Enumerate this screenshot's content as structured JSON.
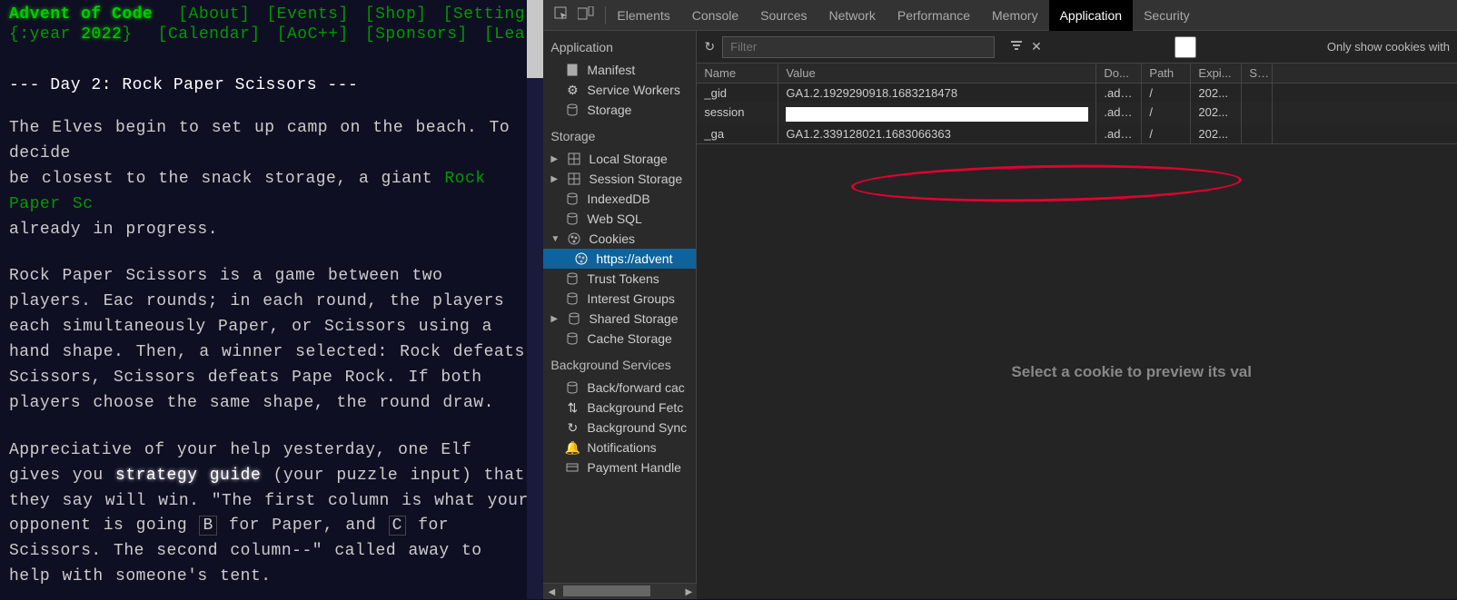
{
  "aoc": {
    "title": "Advent of Code",
    "nav": {
      "about": "[About]",
      "events": "[Events]",
      "shop": "[Shop]",
      "settings": "[Settings]"
    },
    "year_prefix": "{:year ",
    "year": "2022",
    "year_suffix": "}",
    "subnav": {
      "calendar": "[Calendar]",
      "aocpp": "[AoC++]",
      "sponsors": "[Sponsors]",
      "leaderboard": "[Lea"
    },
    "h2": "--- Day 2: Rock Paper Scissors ---",
    "p1a": "The Elves begin to set up camp on the beach. To decide",
    "p1b": "be closest to the snack storage, a giant ",
    "p1link": "Rock Paper Sc",
    "p1c": "already in progress.",
    "p2": "Rock Paper Scissors is a game between two players. Eac rounds; in each round, the players each simultaneously Paper, or Scissors using a hand shape. Then, a winner selected: Rock defeats Scissors, Scissors defeats Pape Rock. If both players choose the same shape, the round draw.",
    "p3a": "Appreciative of your help yesterday, one Elf gives you",
    "p3em": "strategy guide",
    "p3b": " (your puzzle input) that they say will win. \"The first column is what your opponent is going ",
    "p3code1": "B",
    "p3c": " for Paper, and ",
    "p3code2": "C",
    "p3d": " for Scissors. The second column--\" called away to help with someone's tent."
  },
  "devtools": {
    "tabs": [
      "Elements",
      "Console",
      "Sources",
      "Network",
      "Performance",
      "Memory",
      "Application",
      "Security"
    ],
    "active_tab": "Application",
    "side": {
      "app_title": "Application",
      "app_items": [
        "Manifest",
        "Service Workers",
        "Storage"
      ],
      "storage_title": "Storage",
      "storage_items": [
        "Local Storage",
        "Session Storage",
        "IndexedDB",
        "Web SQL"
      ],
      "cookies_label": "Cookies",
      "cookies_child": "https://advent",
      "storage_items2": [
        "Trust Tokens",
        "Interest Groups",
        "Shared Storage",
        "Cache Storage"
      ],
      "bg_title": "Background Services",
      "bg_items": [
        "Back/forward cac",
        "Background Fetc",
        "Background Sync",
        "Notifications",
        "Payment Handle"
      ]
    },
    "toolbar": {
      "filter_placeholder": "Filter",
      "only_cookies": "Only show cookies with"
    },
    "table": {
      "headers": [
        "Name",
        "Value",
        "Do...",
        "Path",
        "Expi...",
        "Siz"
      ],
      "rows": [
        {
          "name": "_gid",
          "value": "GA1.2.1929290918.1683218478",
          "domain": ".adv...",
          "path": "/",
          "expires": "202...",
          "size": ""
        },
        {
          "name": "session",
          "value": "",
          "domain": ".adv...",
          "path": "/",
          "expires": "202...",
          "size": "",
          "redacted": true
        },
        {
          "name": "_ga",
          "value": "GA1.2.339128021.1683066363",
          "domain": ".adv...",
          "path": "/",
          "expires": "202...",
          "size": ""
        }
      ]
    },
    "preview": "Select a cookie to preview its val"
  }
}
